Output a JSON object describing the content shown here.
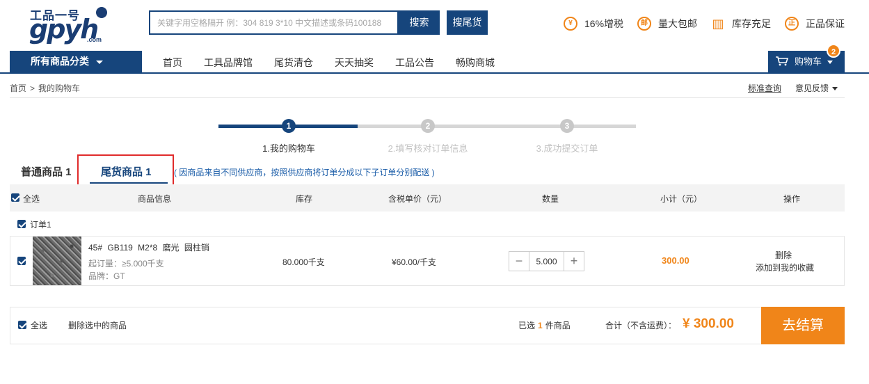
{
  "logo": {
    "line1": "工品一号",
    "line2": "gpyh",
    "line3": ".com"
  },
  "search": {
    "placeholder": "关键字用空格隔开 例：304 819 3*10 中文描述或条码100188",
    "search_label": "搜索",
    "tail_label": "搜尾货"
  },
  "perks": [
    {
      "icon": "¥",
      "icon_name": "yuan-icon",
      "label": "16%增税"
    },
    {
      "icon": "邮",
      "icon_name": "mail-icon",
      "label": "量大包邮"
    },
    {
      "icon": "▥",
      "icon_name": "warehouse-icon",
      "label": "库存充足"
    },
    {
      "icon": "正",
      "icon_name": "genuine-icon",
      "label": "正品保证"
    }
  ],
  "nav": {
    "category_label": "所有商品分类",
    "links": [
      "首页",
      "工具品牌馆",
      "尾货清仓",
      "天天抽奖",
      "工品公告",
      "畅购商城"
    ],
    "cart_label": "购物车",
    "cart_count": "2"
  },
  "breadcrumb": {
    "home": "首页",
    "sep": ">",
    "current": "我的购物车"
  },
  "top_links": {
    "standard": "标准查询",
    "feedback": "意见反馈"
  },
  "steps": [
    {
      "num": "1",
      "label": "1.我的购物车"
    },
    {
      "num": "2",
      "label": "2.填写核对订单信息"
    },
    {
      "num": "3",
      "label": "3.成功提交订单"
    }
  ],
  "tabs": {
    "normal": "普通商品 1",
    "tail": "尾货商品 1",
    "note": "( 因商品来自不同供应商，按照供应商将订单分成以下子订单分别配送 )"
  },
  "table_header": {
    "select_all": "全选",
    "info": "商品信息",
    "stock": "库存",
    "price": "含税单价（元）",
    "qty": "数量",
    "subtotal": "小计（元）",
    "ops": "操作"
  },
  "order": {
    "label": "订单1",
    "item": {
      "name": "45#  GB119  M2*8  磨光  圆柱销",
      "min_order": "起订量：≥5.000千支",
      "brand": "品牌：GT",
      "stock": "80.000千支",
      "price": "¥60.00/千支",
      "quantity": "5.000",
      "subtotal": "300.00",
      "delete": "删除",
      "favorite": "添加到我的收藏"
    }
  },
  "footer": {
    "select_all": "全选",
    "delete_selected": "删除选中的商品",
    "selected_prefix": "已选",
    "selected_count": "1",
    "selected_suffix": "件商品",
    "total_label": "合计（不含运费）：",
    "total": "¥ 300.00",
    "checkout": "去结算"
  }
}
